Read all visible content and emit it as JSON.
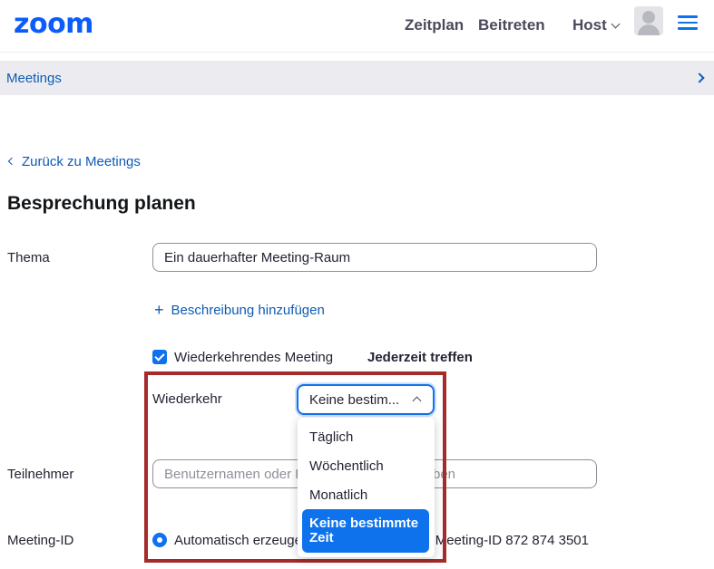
{
  "header": {
    "logo_text": "zoom",
    "nav": {
      "schedule": "Zeitplan",
      "join": "Beitreten",
      "host": "Host"
    }
  },
  "subbar": {
    "label": "Meetings"
  },
  "back_link": "Zurück zu Meetings",
  "page_title": "Besprechung planen",
  "form": {
    "topic_label": "Thema",
    "topic_value": "Ein dauerhafter Meeting-Raum",
    "add_description": "Beschreibung hinzufügen",
    "recurring_label": "Wiederkehrendes Meeting",
    "recurring_checked": true,
    "anytime_label": "Jederzeit treffen",
    "recurrence_label": "Wiederkehr",
    "recurrence_selected": "Keine bestim...",
    "recurrence_options": [
      "Täglich",
      "Wöchentlich",
      "Monatlich",
      "Keine bestimmte Zeit"
    ],
    "attendees_label": "Teilnehmer",
    "attendees_placeholder": "Benutzernamen oder E-Mail-Adressen eingeben",
    "meeting_id_label": "Meeting-ID",
    "meeting_id_auto": "Automatisch erzeugen",
    "meeting_id_personal": "Persönliche Meeting-ID 872 874 3501"
  },
  "colors": {
    "brand_blue": "#0b5cff",
    "link_blue": "#0e5bb5",
    "accent_blue": "#0e72ed",
    "highlight_red": "#a52a2a"
  }
}
